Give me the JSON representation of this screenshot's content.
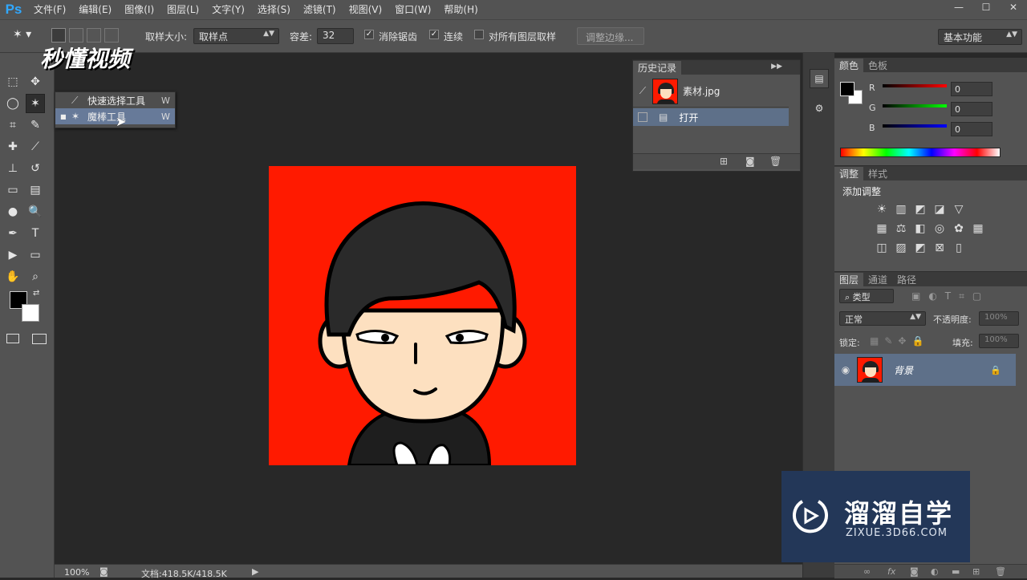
{
  "app": {
    "logo": "Ps",
    "menu": [
      "文件(F)",
      "编辑(E)",
      "图像(I)",
      "图层(L)",
      "文字(Y)",
      "选择(S)",
      "滤镜(T)",
      "视图(V)",
      "窗口(W)",
      "帮助(H)"
    ],
    "window_controls": [
      "—",
      "☐",
      "✕"
    ]
  },
  "options": {
    "sample_size_label": "取样大小:",
    "sample_size_value": "取样点",
    "tolerance_label": "容差:",
    "tolerance_value": "32",
    "antialias_label": "消除锯齿",
    "antialias_checked": true,
    "contiguous_label": "连续",
    "contiguous_checked": true,
    "all_layers_label": "对所有图层取样",
    "all_layers_checked": false,
    "refine_edge_label": "调整边缘...",
    "workspace_value": "基本功能"
  },
  "watermark_top": "秒懂视频",
  "flyout": {
    "items": [
      {
        "label": "快速选择工具",
        "key": "W",
        "selected": false
      },
      {
        "label": "魔棒工具",
        "key": "W",
        "selected": true
      }
    ]
  },
  "history": {
    "tabs": [
      "历史记录"
    ],
    "snapshot_name": "素材.jpg",
    "step_label": "打开"
  },
  "color": {
    "tabs": [
      "颜色",
      "色板"
    ],
    "r_label": "R",
    "r_value": "0",
    "g_label": "G",
    "g_value": "0",
    "b_label": "B",
    "b_value": "0",
    "foreground": "#000000",
    "background": "#ffffff"
  },
  "adjustments": {
    "tabs": [
      "调整",
      "样式"
    ],
    "title": "添加调整"
  },
  "layers": {
    "tabs": [
      "图层",
      "通道",
      "路径"
    ],
    "filter_label": "类型",
    "blend_mode": "正常",
    "opacity_label": "不透明度:",
    "opacity_value": "100%",
    "lock_label": "锁定:",
    "fill_label": "填充:",
    "fill_value": "100%",
    "layer_name": "背景"
  },
  "status": {
    "zoom": "100%",
    "doc_info": "文档:418.5K/418.5K"
  },
  "brand": {
    "title": "溜溜自学",
    "url": "ZIXUE.3D66.COM"
  },
  "colors": {
    "canvas_red": "#ff1a00",
    "ps_blue": "#31a8ff",
    "panel": "#535353"
  }
}
